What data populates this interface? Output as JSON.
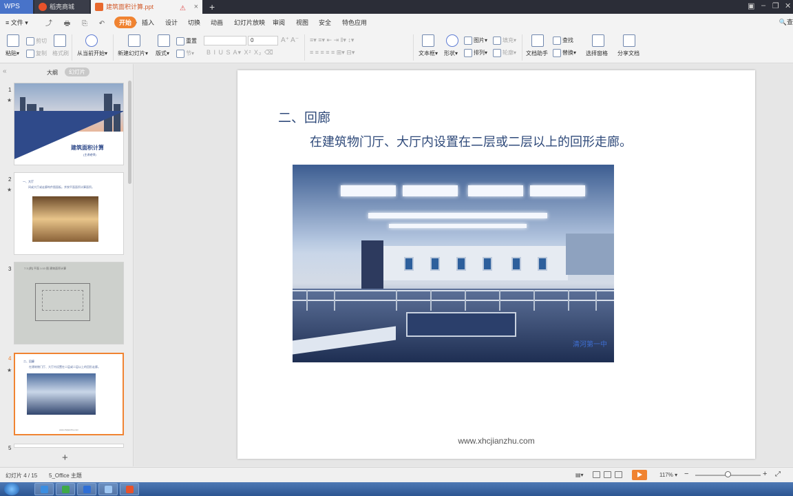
{
  "titlebar": {
    "app_label": "WPS",
    "tabs": [
      {
        "label": "稻壳商城"
      },
      {
        "label": "建筑面积计算.ppt"
      }
    ],
    "new_tab": "+",
    "warn_glyph": "⚠",
    "close_glyph": "×",
    "controls": [
      "▣",
      "–",
      "❐",
      "✕"
    ]
  },
  "menu": {
    "file_label": "≡ 文件 ▾",
    "qat": "⤴ 🖶 ⎘ ↶ ↷ ▿",
    "items": [
      "开始",
      "插入",
      "设计",
      "切换",
      "动画",
      "幻灯片放映",
      "审阅",
      "视图",
      "安全",
      "特色应用"
    ],
    "search_label": "🔍查"
  },
  "ribbon": {
    "paste": "粘贴▾",
    "cut": "剪切",
    "copy": "复制",
    "format_painter": "格式刷",
    "from_current": "从当前开始▾",
    "new_slide": "新建幻灯片▾",
    "layout": "版式▾",
    "reset": "重置",
    "section": "节▾",
    "font_name": "",
    "font_size": "0",
    "text_box": "文本框▾",
    "shapes": "形状▾",
    "picture": "图片▾",
    "fill": "填充▾",
    "arrange": "排列▾",
    "outline": "轮廓▾",
    "doc_helper": "文档助手",
    "find": "查找",
    "replace": "替换▾",
    "select_pane": "选择窗格",
    "share_doc": "分享文档",
    "font_buttons": "B  I  U  S  A▾  X²  X₂  ⌫",
    "para_buttons": "≡▾ ≡▾ ⇤ ⇥ ‖▾ ↕▾",
    "align_buttons": "≡ ≡ ≡ ≡ ≡ ⊞▾ ⊟▾"
  },
  "leftpanel": {
    "collapse": "«",
    "tab_outline": "大纲",
    "tab_slides": "幻灯片",
    "slides": [
      {
        "num": "1",
        "title": "建筑面积计算",
        "subtitle": "(主讲老师)"
      },
      {
        "num": "2",
        "heading": "一、大厅",
        "text": "间或大厅或走廊构件图面板。并按平面面积计算面积。"
      },
      {
        "num": "3",
        "text": "7.3 [例] 平面 1:10 图 建筑面积计算"
      },
      {
        "num": "4",
        "heading": "二、回廊",
        "text": "在建筑物门厅、大厅内设置在二层或二层以上的回形走廊。",
        "url": "www.xhcjianzhu.com"
      },
      {
        "num": "5"
      }
    ],
    "star": "★",
    "add_button": "+"
  },
  "slide": {
    "heading": "二、回廊",
    "body": "在建筑物门厅、大厅内设置在二层或二层以上的回形走廊。",
    "photo_sign": "清河第一中",
    "url": "www.xhcjianzhu.com"
  },
  "status": {
    "slide_counter": "幻灯片 4 / 15",
    "theme": "5_Office 主题",
    "notes_glyph": "▤▾",
    "zoom": "117% ▾",
    "zoom_minus": "−",
    "zoom_plus": "+",
    "fit_glyph": "⤢"
  },
  "colors": {
    "accent": "#f08331",
    "slide_text": "#2f4a7a",
    "titlebar": "#2b2d37"
  }
}
